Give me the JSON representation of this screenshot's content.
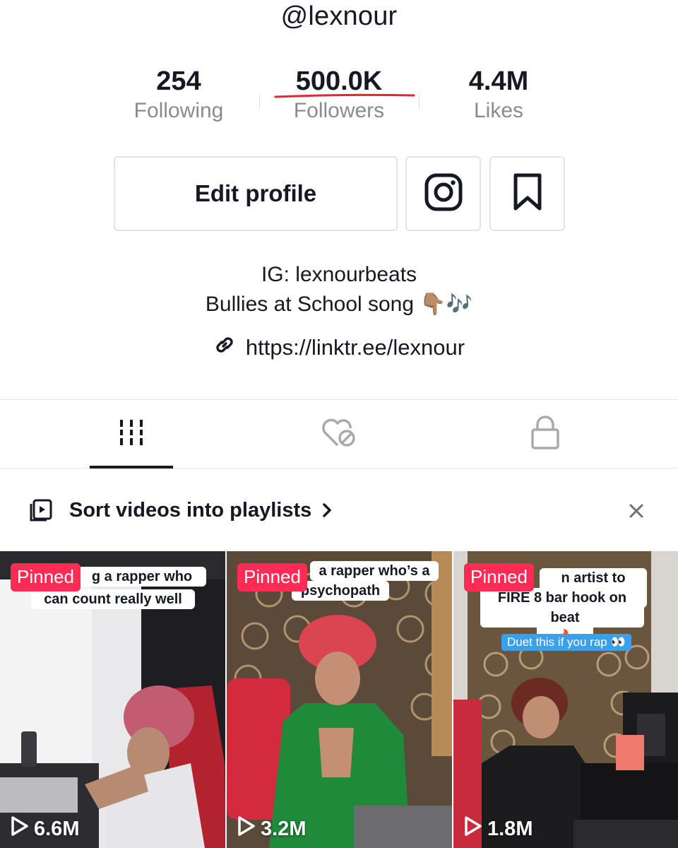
{
  "profile": {
    "username": "@lexnour",
    "bio_line1": "IG: lexnourbeats",
    "bio_line2": "Bullies at School song 👇🏽🎶",
    "link": "https://linktr.ee/lexnour"
  },
  "stats": {
    "following": {
      "value": "254",
      "label": "Following"
    },
    "followers": {
      "value": "500.0K",
      "label": "Followers"
    },
    "likes": {
      "value": "4.4M",
      "label": "Likes"
    }
  },
  "actions": {
    "edit_profile": "Edit profile",
    "instagram_icon": "instagram-icon",
    "bookmark_icon": "bookmark-icon"
  },
  "tabs": [
    {
      "icon": "grid-icon",
      "selected": true
    },
    {
      "icon": "liked-hidden-icon",
      "selected": false
    },
    {
      "icon": "lock-icon",
      "selected": false
    }
  ],
  "playlist_prompt": {
    "text": "Sort videos into playlists"
  },
  "videos": [
    {
      "pinned": "Pinned",
      "caption_line1": "g a rapper who",
      "caption_line2": "can count really well",
      "views": "6.6M"
    },
    {
      "pinned": "Pinned",
      "caption_line1": "a rapper who’s a",
      "caption_line2": "psychopath",
      "views": "3.2M"
    },
    {
      "pinned": "Pinned",
      "caption_line1": "n artist to drop a",
      "caption_line2": "FIRE 8 bar hook on this",
      "caption_line3": "beat 🔥",
      "duet": "Duet this if you rap 👀",
      "views": "1.8M"
    }
  ],
  "colors": {
    "accent": "#fe2c55",
    "text": "#161823",
    "muted": "#8a8b91",
    "underline": "#e0282f",
    "duet": "#3aa0ea"
  }
}
